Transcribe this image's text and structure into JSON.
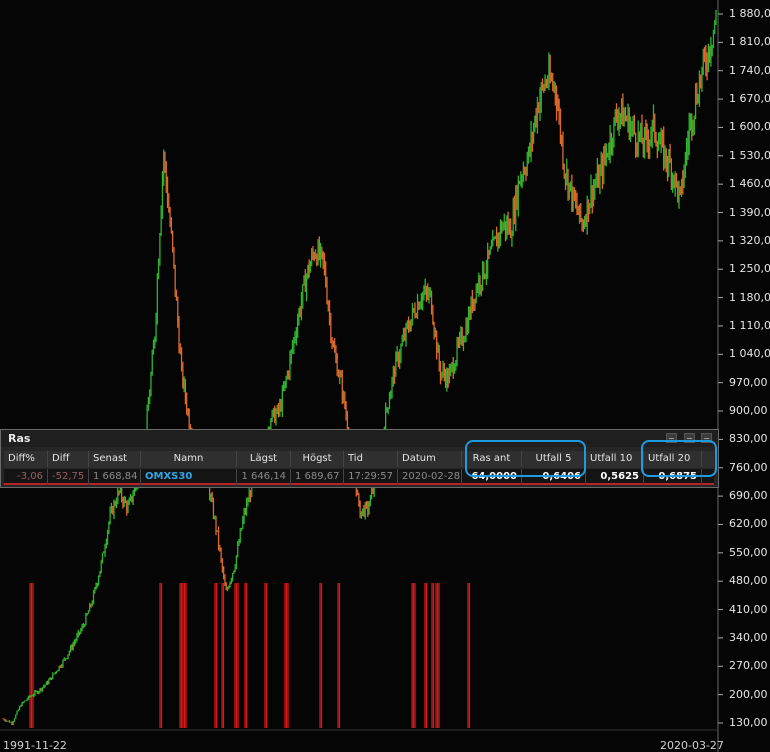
{
  "chart_data": {
    "type": "line",
    "title": "",
    "ylim": [
      125,
      1885
    ],
    "yticks": [
      130,
      200,
      270,
      340,
      410,
      480,
      550,
      620,
      690,
      760,
      830,
      900,
      970,
      1040,
      1110,
      1180,
      1250,
      1320,
      1390,
      1460,
      1530,
      1600,
      1670,
      1740,
      1810,
      1880
    ],
    "ytick_labels": [
      "130,00",
      "200,00",
      "270,00",
      "340,00",
      "410,00",
      "480,00",
      "550,00",
      "620,00",
      "690,00",
      "760,00",
      "830,00",
      "900,00",
      "970,00",
      "1 040,00",
      "1 110,00",
      "1 180,00",
      "1 250,00",
      "1 320,00",
      "1 390,00",
      "1 460,00",
      "1 530,00",
      "1 600,00",
      "1 670,00",
      "1 740,00",
      "1 810,00",
      "1 880,00"
    ],
    "x_start": "1991-11-22",
    "x_end": "2020-03-27",
    "series": [
      {
        "values": [
          140,
          130,
          175,
          195,
          210,
          230,
          260,
          290,
          330,
          370,
          430,
          520,
          640,
          700,
          660,
          720,
          840,
          1080,
          1540,
          1300,
          1000,
          860,
          810,
          720,
          600,
          450,
          520,
          640,
          720,
          800,
          880,
          900,
          1000,
          1120,
          1230,
          1300,
          1260,
          1060,
          960,
          820,
          650,
          660,
          760,
          900,
          1010,
          1080,
          1140,
          1190,
          1180,
          1000,
          980,
          1050,
          1110,
          1200,
          1250,
          1300,
          1360,
          1350,
          1480,
          1530,
          1660,
          1720,
          1700,
          1500,
          1420,
          1360,
          1440,
          1480,
          1560,
          1640,
          1620,
          1580,
          1560,
          1600,
          1540,
          1500,
          1420,
          1600,
          1700,
          1780,
          1870
        ]
      }
    ],
    "signal_bars": {
      "color": "#e01818",
      "count": 40
    }
  },
  "ras_panel": {
    "title": "Ras",
    "headers": [
      "Diff%",
      "Diff",
      "Senast",
      "Namn",
      "Lägst",
      "Högst",
      "Tid",
      "Datum",
      "Ras ant",
      "Utfall 5",
      "Utfall 10",
      "Utfall 20"
    ],
    "row": {
      "diff_pct": "-3,06",
      "diff": "-52,75",
      "senast": "1 668,84",
      "namn": "OMXS30",
      "lagst": "1 646,14",
      "hogst": "1 689,67",
      "tid": "17:29:57",
      "datum": "2020-02-28",
      "ras_ant": "64,0000",
      "utfall_5": "0,6406",
      "utfall_10": "0,5625",
      "utfall_20": "0,6875"
    }
  },
  "x_axis": {
    "start_label": "1991-11-22",
    "end_label": "2020-03-27"
  },
  "colors": {
    "background": "#050505",
    "candle_up": "#2fb52f",
    "candle_down": "#e06a2a",
    "signal": "#e01818",
    "highlight": "#1e9be0",
    "name_text": "#2fa6e6"
  }
}
